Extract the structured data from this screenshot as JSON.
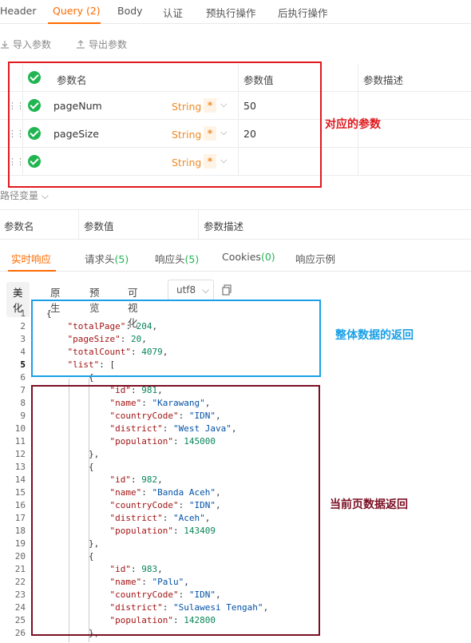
{
  "tabs": [
    {
      "label": "Header"
    },
    {
      "label": "Query (2)"
    },
    {
      "label": "Body"
    },
    {
      "label": "认证"
    },
    {
      "label": "预执行操作"
    },
    {
      "label": "后执行操作"
    }
  ],
  "toolbar": {
    "import_label": "导入参数",
    "export_label": "导出参数"
  },
  "query_table": {
    "headers": {
      "name": "参数名",
      "value": "参数值",
      "desc": "参数描述"
    },
    "rows": [
      {
        "name": "pageNum",
        "type": "String",
        "required": "*",
        "value": "50"
      },
      {
        "name": "pageSize",
        "type": "String",
        "required": "*",
        "value": "20"
      },
      {
        "name": "",
        "type": "String",
        "required": "*",
        "value": ""
      }
    ]
  },
  "annotations": {
    "params": "对应的参数",
    "whole": "整体数据的返回",
    "page": "当前页数据返回"
  },
  "colors": {
    "params": "#e0191e",
    "whole": "#1aa0e6",
    "page": "#7a0f23",
    "accent": "#ff6a00",
    "check": "#21b551"
  },
  "path_vars": {
    "label": "路径变量 ⌵"
  },
  "path_table": {
    "headers": {
      "name": "参数名",
      "value": "参数值",
      "desc": "参数描述"
    }
  },
  "response_tabs": [
    {
      "label": "实时响应",
      "count": ""
    },
    {
      "label": "请求头",
      "count": "(5)"
    },
    {
      "label": "响应头",
      "count": "(5)"
    },
    {
      "label": "Cookies",
      "count": "(0)"
    },
    {
      "label": "响应示例",
      "count": ""
    }
  ],
  "format_buttons": [
    "美化",
    "原生",
    "预览",
    "可视化"
  ],
  "encoding": "utf8",
  "code_lines": [
    {
      "n": "1",
      "t": "{"
    },
    {
      "n": "2",
      "t": "    \"totalPage\": 204,"
    },
    {
      "n": "3",
      "t": "    \"pageSize\": 20,"
    },
    {
      "n": "4",
      "t": "    \"totalCount\": 4079,"
    },
    {
      "n": "5",
      "t": "    \"list\": ["
    },
    {
      "n": "6",
      "t": "        {"
    },
    {
      "n": "7",
      "t": "            \"id\": 981,"
    },
    {
      "n": "8",
      "t": "            \"name\": \"Karawang\","
    },
    {
      "n": "9",
      "t": "            \"countryCode\": \"IDN\","
    },
    {
      "n": "10",
      "t": "            \"district\": \"West Java\","
    },
    {
      "n": "11",
      "t": "            \"population\": 145000"
    },
    {
      "n": "12",
      "t": "        },"
    },
    {
      "n": "13",
      "t": "        {"
    },
    {
      "n": "14",
      "t": "            \"id\": 982,"
    },
    {
      "n": "15",
      "t": "            \"name\": \"Banda Aceh\","
    },
    {
      "n": "16",
      "t": "            \"countryCode\": \"IDN\","
    },
    {
      "n": "17",
      "t": "            \"district\": \"Aceh\","
    },
    {
      "n": "18",
      "t": "            \"population\": 143409"
    },
    {
      "n": "19",
      "t": "        },"
    },
    {
      "n": "20",
      "t": "        {"
    },
    {
      "n": "21",
      "t": "            \"id\": 983,"
    },
    {
      "n": "22",
      "t": "            \"name\": \"Palu\","
    },
    {
      "n": "23",
      "t": "            \"countryCode\": \"IDN\","
    },
    {
      "n": "24",
      "t": "            \"district\": \"Sulawesi Tengah\","
    },
    {
      "n": "25",
      "t": "            \"population\": 142800"
    },
    {
      "n": "26",
      "t": "        },"
    }
  ]
}
